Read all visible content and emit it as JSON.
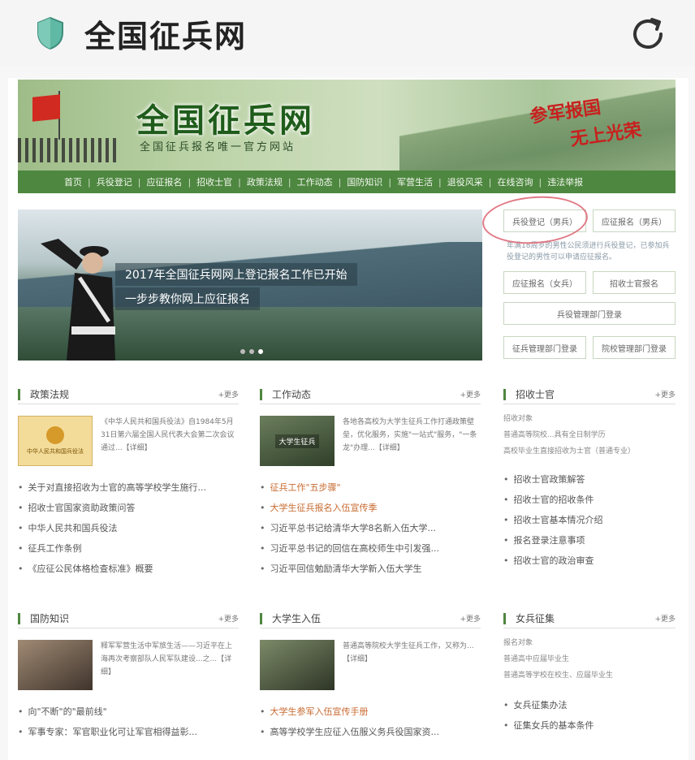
{
  "app": {
    "title": "全国征兵网",
    "shield_icon": "shield-icon",
    "refresh_icon": "refresh-icon"
  },
  "banner": {
    "brand": "全国征兵网",
    "subtitle": "全国征兵报名唯一官方网站",
    "slogan1": "参军报国",
    "slogan2": "无上光荣"
  },
  "nav": [
    "首页",
    "兵役登记",
    "应征报名",
    "招收士官",
    "政策法规",
    "工作动态",
    "国防知识",
    "军营生活",
    "退役风采",
    "在线咨询",
    "违法举报"
  ],
  "hero": {
    "line1": "2017年全国征兵网网上登记报名工作已开始",
    "line2": "一步步教你网上应征报名"
  },
  "quick": {
    "b1": "兵役登记（男兵）",
    "b2": "应征报名（男兵）",
    "desc": "年满18周岁的男性公民须进行兵役登记，已参加兵役登记的男性可以申请应征报名。",
    "b3": "应征报名（女兵）",
    "b4": "招收士官报名",
    "b5": "兵役管理部门登录",
    "b6": "征兵管理部门登录",
    "b7": "院校管理部门登录"
  },
  "sections": {
    "s1": {
      "title": "政策法规",
      "more": "+更多",
      "feature_text": "《中华人民共和国兵役法》自1984年5月31日第六届全国人民代表大会第二次会议通过...【详细】",
      "thumb_text": "中华人民共和国兵役法",
      "items": [
        "关于对直接招收为士官的高等学校学生施行...",
        "招收士官国家资助政策问答",
        "中华人民共和国兵役法",
        "征兵工作条例",
        "《应征公民体格检查标准》概要"
      ]
    },
    "s2": {
      "title": "工作动态",
      "more": "+更多",
      "feature_text": "各地各高校为大学生征兵工作打通政策壁垒，优化服务，实施\"一站式\"服务，\"一条龙\"办理...【详细】",
      "thumb_text": "大学生征兵",
      "items": [
        "征兵工作\"五步骤\"",
        "大学生征兵报名入伍宣传季",
        "习近平总书记给清华大学8名新入伍大学...",
        "习近平总书记的回信在高校师生中引发强...",
        "习近平回信勉励清华大学新入伍大学生"
      ]
    },
    "s3": {
      "title": "招收士官",
      "more": "+更多",
      "plain": [
        "招收对象",
        "普通高等院校...具有全日制学历",
        "高校毕业生直接招收为士官（普通专业）"
      ],
      "items": [
        "招收士官政策解答",
        "招收士官的招收条件",
        "招收士官基本情况介绍",
        "报名登录注意事项",
        "招收士官的政治审查"
      ]
    },
    "s4": {
      "title": "国防知识",
      "more": "+更多",
      "feature_text": "释军军营生活中军旅生活——习近平在上海再次考察部队人民军队建设...之...【详细】",
      "items": [
        "向\"不断\"的\"最前线\"",
        "军事专家：军官职业化可让军官相得益彰..."
      ]
    },
    "s5": {
      "title": "大学生入伍",
      "more": "+更多",
      "feature_text": "普通高等院校大学生征兵工作，又称为...【详细】",
      "items": [
        "大学生参军入伍宣传手册",
        "高等学校学生应征入伍服义务兵役国家资..."
      ]
    },
    "s6": {
      "title": "女兵征集",
      "more": "+更多",
      "plain": [
        "报名对象",
        "普通高中应届毕业生",
        "普通高等学校在校生、应届毕业生"
      ],
      "items": [
        "女兵征集办法",
        "征集女兵的基本条件"
      ]
    }
  },
  "colors": {
    "nav_green": "#4e8740",
    "accent_red": "#c8201e"
  }
}
